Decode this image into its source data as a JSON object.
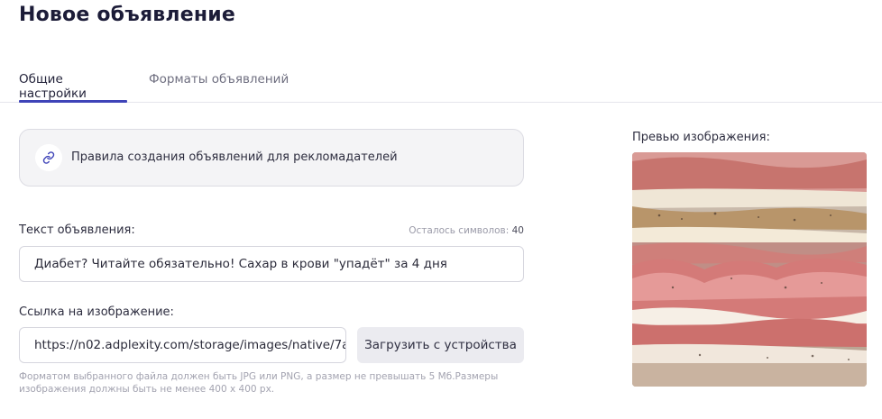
{
  "page": {
    "title": "Новое объявление"
  },
  "tabs": [
    {
      "label": "Общие настройки",
      "active": true
    },
    {
      "label": "Форматы объявлений",
      "active": false
    }
  ],
  "rules": {
    "icon": "link-icon",
    "label": "Правила создания объявлений для рекломадателей"
  },
  "ad_text": {
    "label": "Текст объявления:",
    "counter_label": "Осталось символов:",
    "counter_value": "40",
    "value": "Диабет? Читайте обязательно! Сахар в крови \"упадёт\" за 4 дня"
  },
  "image_link": {
    "label": "Ссылка на изображение:",
    "value": "https://n02.adplexity.com/storage/images/native/7a",
    "upload_button": "Загрузить с устройства",
    "hint": "Форматом выбранного файла должен быть JPG или PNG, а размер не превышать 5 Мб.Размеры изображения должны быть не менее 400 x 400 px."
  },
  "preview": {
    "label": "Превью изображения:",
    "image": "cured-meat-photo"
  },
  "colors": {
    "accent": "#3e43b8",
    "title": "#1c1c38",
    "card_bg": "#f4f4f6",
    "button_bg": "#ebebf0",
    "hint": "#a3a3b0"
  }
}
